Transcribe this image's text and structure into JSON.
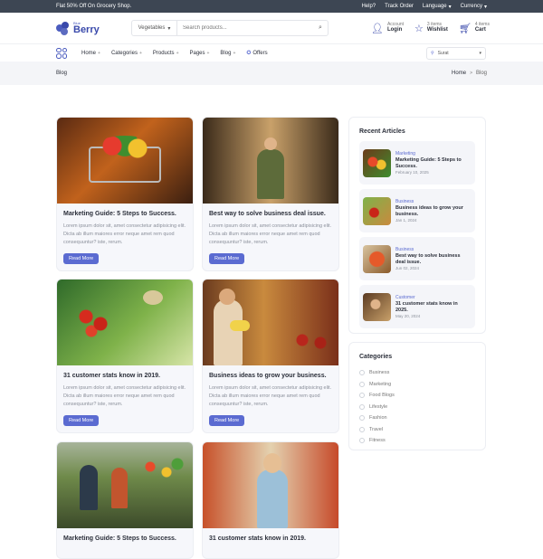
{
  "topbar": {
    "promo": "Flat 50% Off On Grocery Shop.",
    "help": "Help?",
    "track": "Track Order",
    "language": "Language",
    "currency": "Currency"
  },
  "logo": {
    "small": "Blue",
    "name": "Berry"
  },
  "search": {
    "category": "Vegetables",
    "placeholder": "Search products..."
  },
  "account": {
    "top": "Account",
    "label": "Login"
  },
  "wishlist": {
    "top": "3 items",
    "label": "Wishlist"
  },
  "cart": {
    "top": "4 items",
    "label": "Cart"
  },
  "nav": {
    "items": [
      "Home",
      "Categories",
      "Products",
      "Pages",
      "Blog"
    ],
    "offers": "Offers",
    "location": "Surat"
  },
  "breadcrumb": {
    "title": "Blog",
    "home": "Home",
    "sep": ">",
    "current": "Blog"
  },
  "posts": [
    {
      "title": "Marketing Guide: 5 Steps to Success.",
      "excerpt": "Lorem ipsum dolor sit, amet consectetur adipisicing elit. Dicta ab illum maiores error neque amet rem quod consequuntur? iste, rerum.",
      "button": "Read More"
    },
    {
      "title": "Best way to solve business deal issue.",
      "excerpt": "Lorem ipsum dolor sit, amet consectetur adipisicing elit. Dicta ab illum maiores error neque amet rem quod consequuntur? iste, rerum.",
      "button": "Read More"
    },
    {
      "title": "31 customer stats know in 2019.",
      "excerpt": "Lorem ipsum dolor sit, amet consectetur adipisicing elit. Dicta ab illum maiores error neque amet rem quod consequuntur? iste, rerum.",
      "button": "Read More"
    },
    {
      "title": "Business ideas to grow your business.",
      "excerpt": "Lorem ipsum dolor sit, amet consectetur adipisicing elit. Dicta ab illum maiores error neque amet rem quod consequuntur? iste, rerum.",
      "button": "Read More"
    },
    {
      "title": "Marketing Guide: 5 Steps to Success.",
      "excerpt": "",
      "button": ""
    },
    {
      "title": "31 customer stats know in 2019.",
      "excerpt": "",
      "button": ""
    }
  ],
  "recent": {
    "title": "Recent Articles",
    "items": [
      {
        "tag": "Marketing",
        "title": "Marketing Guide: 5 Steps to Success.",
        "date": "February 10, 2025"
      },
      {
        "tag": "Business",
        "title": "Business ideas to grow your business.",
        "date": "Jan 1, 2024"
      },
      {
        "tag": "Business",
        "title": "Best way to solve business deal issue.",
        "date": "Jun 02, 2024"
      },
      {
        "tag": "Customer",
        "title": "31 customer stats know in 2025.",
        "date": "May 20, 2024"
      }
    ]
  },
  "categories": {
    "title": "Categories",
    "items": [
      "Business",
      "Marketing",
      "Food Blogs",
      "Lifestyle",
      "Fashion",
      "Travel",
      "Fitness"
    ]
  },
  "colors": {
    "accent": "#5b6bd1",
    "brand": "#3949ab",
    "topbar": "#3d4653"
  }
}
